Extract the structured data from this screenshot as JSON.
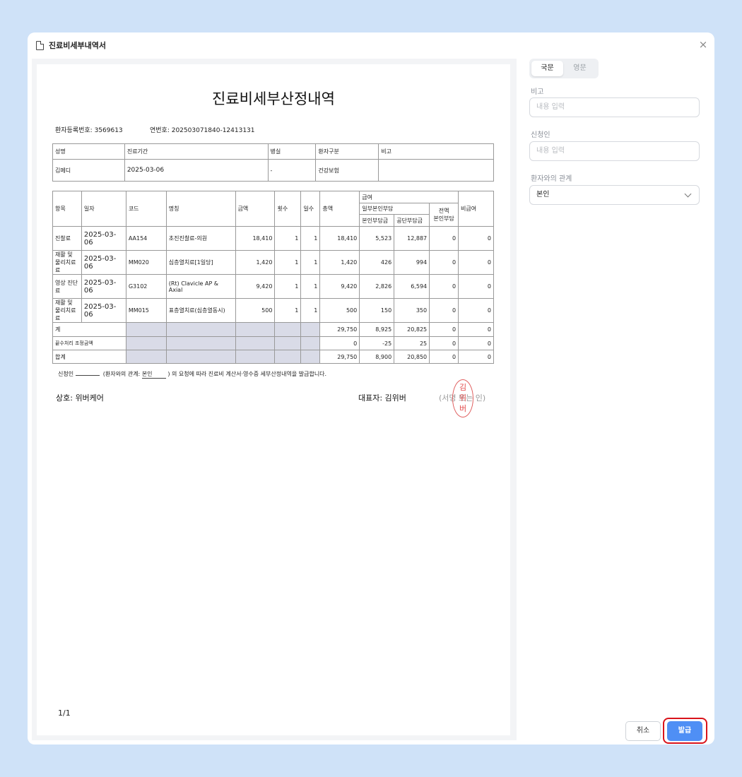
{
  "dialog": {
    "title": "진료비세부내역서",
    "close_label": "×"
  },
  "document": {
    "title": "진료비세부산정내역",
    "patient_reg_label": "환자등록번호: 3569613",
    "serial_label": "연번호: 202503071840-12413131",
    "info_headers": [
      "성명",
      "진료기간",
      "병실",
      "환자구분",
      "비고"
    ],
    "info_values": [
      "김메디",
      "2025-03-06",
      "-",
      "건강보험",
      ""
    ],
    "item_headers": {
      "item": "항목",
      "date": "일자",
      "code": "코드",
      "name": "명칭",
      "amount": "금액",
      "times": "횟수",
      "days": "일수",
      "total": "총액",
      "covered": "급여",
      "partial": "일부본인부담",
      "self": "본인부담금",
      "public": "공단부담금",
      "full_self": "전액\n본인부담",
      "non_covered": "비급여"
    },
    "rows": [
      {
        "item": "진찰료",
        "date": "2025-03-06",
        "code": "AA154",
        "name": "초진진찰료-의원",
        "amount": "18,410",
        "times": "1",
        "days": "1",
        "total": "18,410",
        "self": "5,523",
        "public": "12,887",
        "full_self": "0",
        "non_covered": "0"
      },
      {
        "item": "재활 및 물리치료료",
        "date": "2025-03-06",
        "code": "MM020",
        "name": "심층열치료[1일당]",
        "amount": "1,420",
        "times": "1",
        "days": "1",
        "total": "1,420",
        "self": "426",
        "public": "994",
        "full_self": "0",
        "non_covered": "0"
      },
      {
        "item": "영상 진단료",
        "date": "2025-03-06",
        "code": "G3102",
        "name": "(Rt) Clavicle AP & Axial",
        "amount": "9,420",
        "times": "1",
        "days": "1",
        "total": "9,420",
        "self": "2,826",
        "public": "6,594",
        "full_self": "0",
        "non_covered": "0"
      },
      {
        "item": "재활 및 물리치료료",
        "date": "2025-03-06",
        "code": "MM015",
        "name": "표층열치료(심층열동시)",
        "amount": "500",
        "times": "1",
        "days": "1",
        "total": "500",
        "self": "150",
        "public": "350",
        "full_self": "0",
        "non_covered": "0"
      }
    ],
    "summary": [
      {
        "label": "계",
        "total": "29,750",
        "self": "8,925",
        "public": "20,825",
        "full_self": "0",
        "non_covered": "0"
      },
      {
        "label": "끝수처리 조정금액",
        "total": "0",
        "self": "-25",
        "public": "25",
        "full_self": "0",
        "non_covered": "0"
      },
      {
        "label": "합계",
        "total": "29,750",
        "self": "8,900",
        "public": "20,850",
        "full_self": "0",
        "non_covered": "0"
      }
    ],
    "applicant_prefix": "신청인",
    "relation_prefix": "(환자와의 관계:",
    "relation_value": "본인",
    "applicant_suffix": ") 의 요청에 따라 진료비 계산서·영수증 세부산정내역을 발급합니다.",
    "company": "상호: 위버케어",
    "representative": "대표자: 김위버",
    "sign_hint": "(서명 또는 인)",
    "seal_text": "김\n위\n버",
    "page_indicator": "1/1"
  },
  "panel": {
    "lang_korean": "국문",
    "lang_english": "영문",
    "note_label": "비고",
    "note_placeholder": "내용 입력",
    "applicant_label": "신청인",
    "applicant_placeholder": "내용 입력",
    "relation_label": "환자와의 관계",
    "relation_value": "본인"
  },
  "footer": {
    "cancel_label": "취소",
    "issue_label": "발급"
  },
  "colors": {
    "background": "#cfe2f8",
    "primary": "#4f8ff5",
    "highlight_ring": "#d9131b",
    "seal": "#e34a4a",
    "table_shade": "#d9dbe7"
  }
}
